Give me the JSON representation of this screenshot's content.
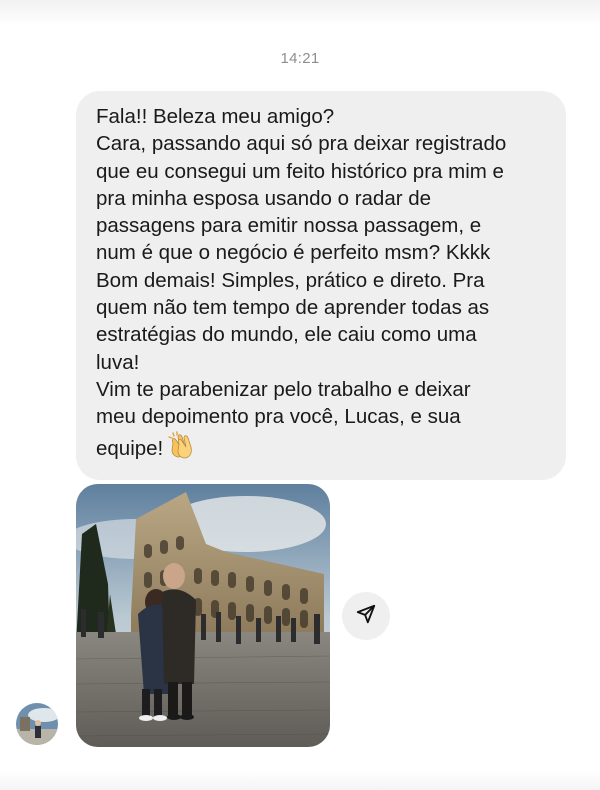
{
  "chat": {
    "timestamp": "14:21",
    "message_lines": [
      "Fala!! Beleza meu amigo?",
      "Cara, passando aqui só pra deixar registrado",
      "que eu consegui um feito histórico pra mim e",
      "pra minha esposa usando o radar de",
      "passagens para emitir nossa passagem, e",
      "num é que o negócio é perfeito msm? Kkkk",
      "Bom demais! Simples, prático e direto. Pra",
      "quem não tem tempo de aprender todas as",
      "estratégias do mundo, ele caiu como uma",
      "luva!",
      "Vim te parabenizar pelo trabalho e deixar",
      "meu depoimento pra você, Lucas, e sua",
      "equipe!"
    ],
    "message_emoji": "clapping-hands-icon",
    "photo": {
      "subject": "couple-photo"
    },
    "share_icon": "send-icon",
    "avatar_icon": "contact-avatar"
  },
  "colors": {
    "bubble": "#efefef",
    "timestamp": "#8e8e8e",
    "text": "#1a1a1a"
  }
}
